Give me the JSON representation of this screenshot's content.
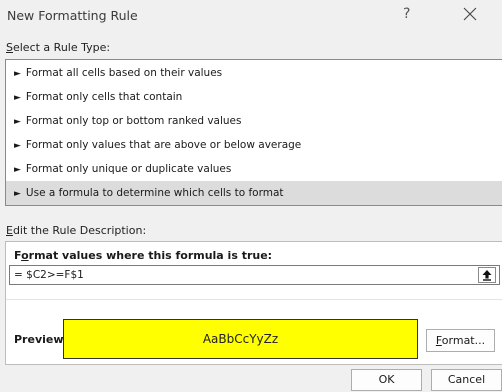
{
  "dialog": {
    "title": "New Formatting Rule",
    "help_glyph": "?"
  },
  "select_rule": {
    "label_prefix": "",
    "label_mnemonic": "S",
    "label_rest": "elect a Rule Type:",
    "items": [
      "Format all cells based on their values",
      "Format only cells that contain",
      "Format only top or bottom ranked values",
      "Format only values that are above or below average",
      "Format only unique or duplicate values",
      "Use a formula to determine which cells to format"
    ],
    "selected_index": 5,
    "arrow_glyph": "►"
  },
  "edit_rule": {
    "label_mnemonic": "E",
    "label_rest": "dit the Rule Description:",
    "formula_label_pre": "F",
    "formula_label_mnemonic": "o",
    "formula_label_rest": "rmat values where this formula is true:",
    "formula_value": "= $C2>=F$1",
    "preview_label": "Preview:",
    "preview_sample": "AaBbCcYyZz",
    "preview_fill": "#ffff00",
    "format_mnemonic": "F",
    "format_rest": "ormat..."
  },
  "buttons": {
    "ok": "OK",
    "cancel": "Cancel"
  }
}
